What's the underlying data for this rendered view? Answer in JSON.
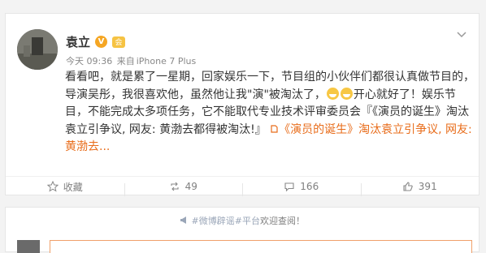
{
  "user": {
    "name": "袁立",
    "verified_badge": "V",
    "vip_badge": "会"
  },
  "meta": {
    "time": "今天 09:36",
    "source_prefix": "来自",
    "source": "iPhone 7 Plus"
  },
  "post": {
    "seg1": "看看吧，就是累了一星期，回家娱乐一下，节目组的小伙伴们都很认真做节目的，导演吴彤，我很喜欢他，虽然他让我\"演\"被淘汰了，",
    "seg2": "开心就好了！娱乐节目，不能完成太多项任务，它不能取代专业技术评审委员会『《演员的诞生》淘汰袁立引争议, 网友: 黄渤去都得被淘汰!』",
    "link_text": "《演员的诞生》淘汰袁立引争议, 网友: 黄渤去..."
  },
  "actions": {
    "favorite": "收藏",
    "repost": "49",
    "comment": "166",
    "like": "391"
  },
  "comments": {
    "topic_tag": "#微博辟谣#平台",
    "topic_welcome": "欢迎查阅！"
  },
  "colors": {
    "accent": "#e86c1a",
    "link": "#eb7350",
    "badge": "#f5a623"
  }
}
